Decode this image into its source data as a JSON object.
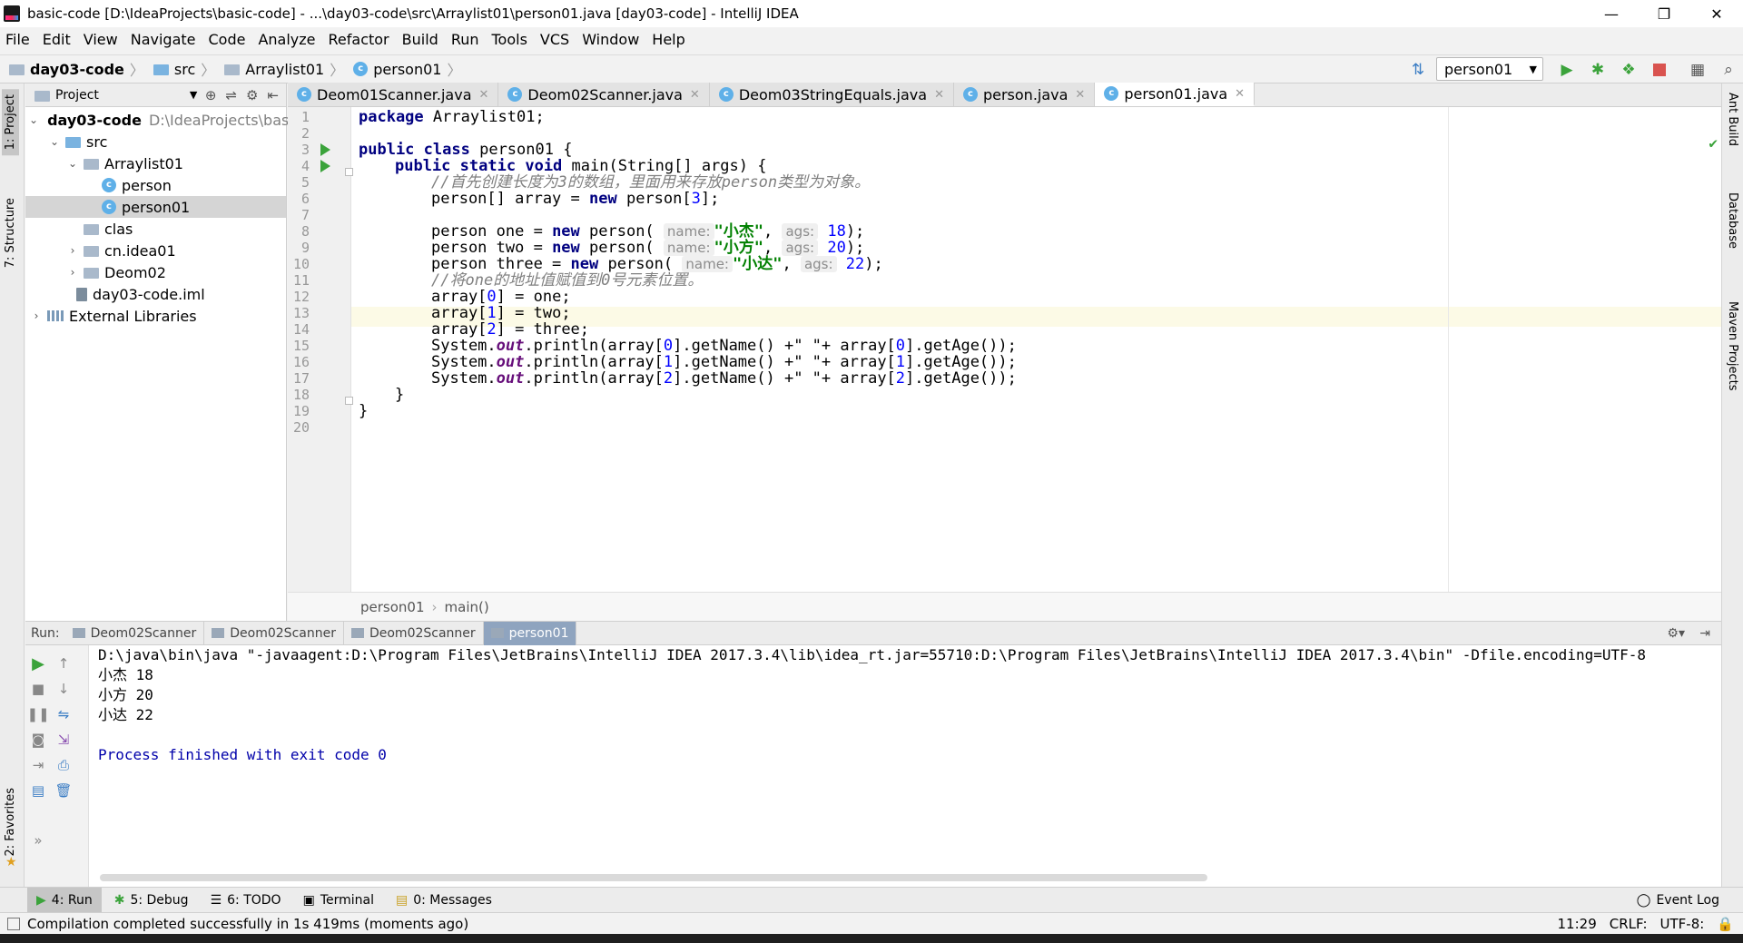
{
  "window": {
    "title": "basic-code [D:\\IdeaProjects\\basic-code] - ...\\day03-code\\src\\Arraylist01\\person01.java [day03-code] - IntelliJ IDEA",
    "minimize": "—",
    "maximize": "❐",
    "close": "✕"
  },
  "menu": [
    "File",
    "Edit",
    "View",
    "Navigate",
    "Code",
    "Analyze",
    "Refactor",
    "Build",
    "Run",
    "Tools",
    "VCS",
    "Window",
    "Help"
  ],
  "breadcrumb": [
    "day03-code",
    "src",
    "Arraylist01",
    "person01"
  ],
  "run_config": "person01",
  "project_panel": {
    "title": "Project",
    "tree": [
      {
        "label": "day03-code",
        "path": "D:\\IdeaProjects\\bas",
        "bold": true
      },
      {
        "label": "src"
      },
      {
        "label": "Arraylist01"
      },
      {
        "label": "person"
      },
      {
        "label": "person01"
      },
      {
        "label": "clas"
      },
      {
        "label": "cn.idea01"
      },
      {
        "label": "Deom02"
      },
      {
        "label": "day03-code.iml"
      },
      {
        "label": "External Libraries"
      }
    ]
  },
  "editor": {
    "tabs": [
      "Deom01Scanner.java",
      "Deom02Scanner.java",
      "Deom03StringEquals.java",
      "person.java",
      "person01.java"
    ],
    "active_tab": "person01.java",
    "line_numbers": [
      "1",
      "2",
      "3",
      "4",
      "5",
      "6",
      "7",
      "8",
      "9",
      "10",
      "11",
      "12",
      "13",
      "14",
      "15",
      "16",
      "17",
      "18",
      "19",
      "20"
    ],
    "code": {
      "l1_kw": "package",
      "l1_rest": " Arraylist01;",
      "l3_kw1": "public",
      "l3_kw2": "class",
      "l3_rest": " person01 {",
      "l4_kw1": "public",
      "l4_kw2": "static",
      "l4_kw3": "void",
      "l4_rest": " main(String[] args) {",
      "l5_comment": "//首先创建长度为3的数组，里面用来存放person类型为对象。",
      "l6_pre": "person[] array = ",
      "l6_kw": "new",
      "l6_post": " person[",
      "l6_num": "3",
      "l6_end": "];",
      "l8_pre": "person one = ",
      "l8_kw": "new",
      "l8_mid": " person(",
      "l8_hint1": "name:",
      "l8_str": "\"小杰\"",
      "l8_comma": ", ",
      "l8_hint2": "ags:",
      "l8_num": "18",
      "l8_end": ");",
      "l9_pre": "person two = ",
      "l9_kw": "new",
      "l9_mid": " person(",
      "l9_hint1": "name:",
      "l9_str": "\"小方\"",
      "l9_comma": ", ",
      "l9_hint2": "ags:",
      "l9_num": "20",
      "l9_end": ");",
      "l10_pre": "person three = ",
      "l10_kw": "new",
      "l10_mid": " person(",
      "l10_hint1": "name:",
      "l10_str": "\"小达\"",
      "l10_comma": ", ",
      "l10_hint2": "ags:",
      "l10_num": "22",
      "l10_end": ");",
      "l11_comment": "//将one的地址值赋值到0号元素位置。",
      "l12_pre": "array[",
      "l12_num": "0",
      "l12_post": "] = one;",
      "l13_pre": "array[",
      "l13_num": "1",
      "l13_post": "] = two;",
      "l14_pre": "array[",
      "l14_num": "2",
      "l14_post": "] = three;",
      "l15_pre": "System.",
      "l15_fld": "out",
      "l15_a": ".println(array[",
      "l15_n1": "0",
      "l15_b": "].getName() +\" \"+ array[",
      "l15_n2": "0",
      "l15_c": "].getAge());",
      "l16_pre": "System.",
      "l16_fld": "out",
      "l16_a": ".println(array[",
      "l16_n1": "1",
      "l16_b": "].getName() +\" \"+ array[",
      "l16_n2": "1",
      "l16_c": "].getAge());",
      "l17_pre": "System.",
      "l17_fld": "out",
      "l17_a": ".println(array[",
      "l17_n1": "2",
      "l17_b": "].getName() +\" \"+ array[",
      "l17_n2": "2",
      "l17_c": "].getAge());",
      "l18": "}",
      "l19": "}"
    },
    "nav_breadcrumb": [
      "person01",
      "main()"
    ]
  },
  "run_panel": {
    "label": "Run:",
    "tabs": [
      "Deom02Scanner",
      "Deom02Scanner",
      "Deom02Scanner",
      "person01"
    ],
    "console": [
      "D:\\java\\bin\\java \"-javaagent:D:\\Program Files\\JetBrains\\IntelliJ IDEA 2017.3.4\\lib\\idea_rt.jar=55710:D:\\Program Files\\JetBrains\\IntelliJ IDEA 2017.3.4\\bin\" -Dfile.encoding=UTF-8",
      "小杰 18",
      "小方 20",
      "小达 22",
      "",
      "Process finished with exit code 0"
    ]
  },
  "tool_windows": {
    "left": [
      "1: Project",
      "7: Structure",
      "2: Favorites"
    ],
    "right": [
      "Ant Build",
      "Database",
      "Maven Projects"
    ]
  },
  "bottom_tabs": [
    "4: Run",
    "5: Debug",
    "6: TODO",
    "Terminal",
    "0: Messages"
  ],
  "event_log": "Event Log",
  "status": {
    "message": "Compilation completed successfully in 1s 419ms (moments ago)",
    "position": "11:29",
    "line_sep": "CRLF:",
    "encoding": "UTF-8:"
  },
  "colors": {
    "keyword": "#000080",
    "string": "#008000",
    "number": "#0000ff",
    "comment": "#808080",
    "run_green": "#3ba33b",
    "stop_red": "#d9534f"
  }
}
